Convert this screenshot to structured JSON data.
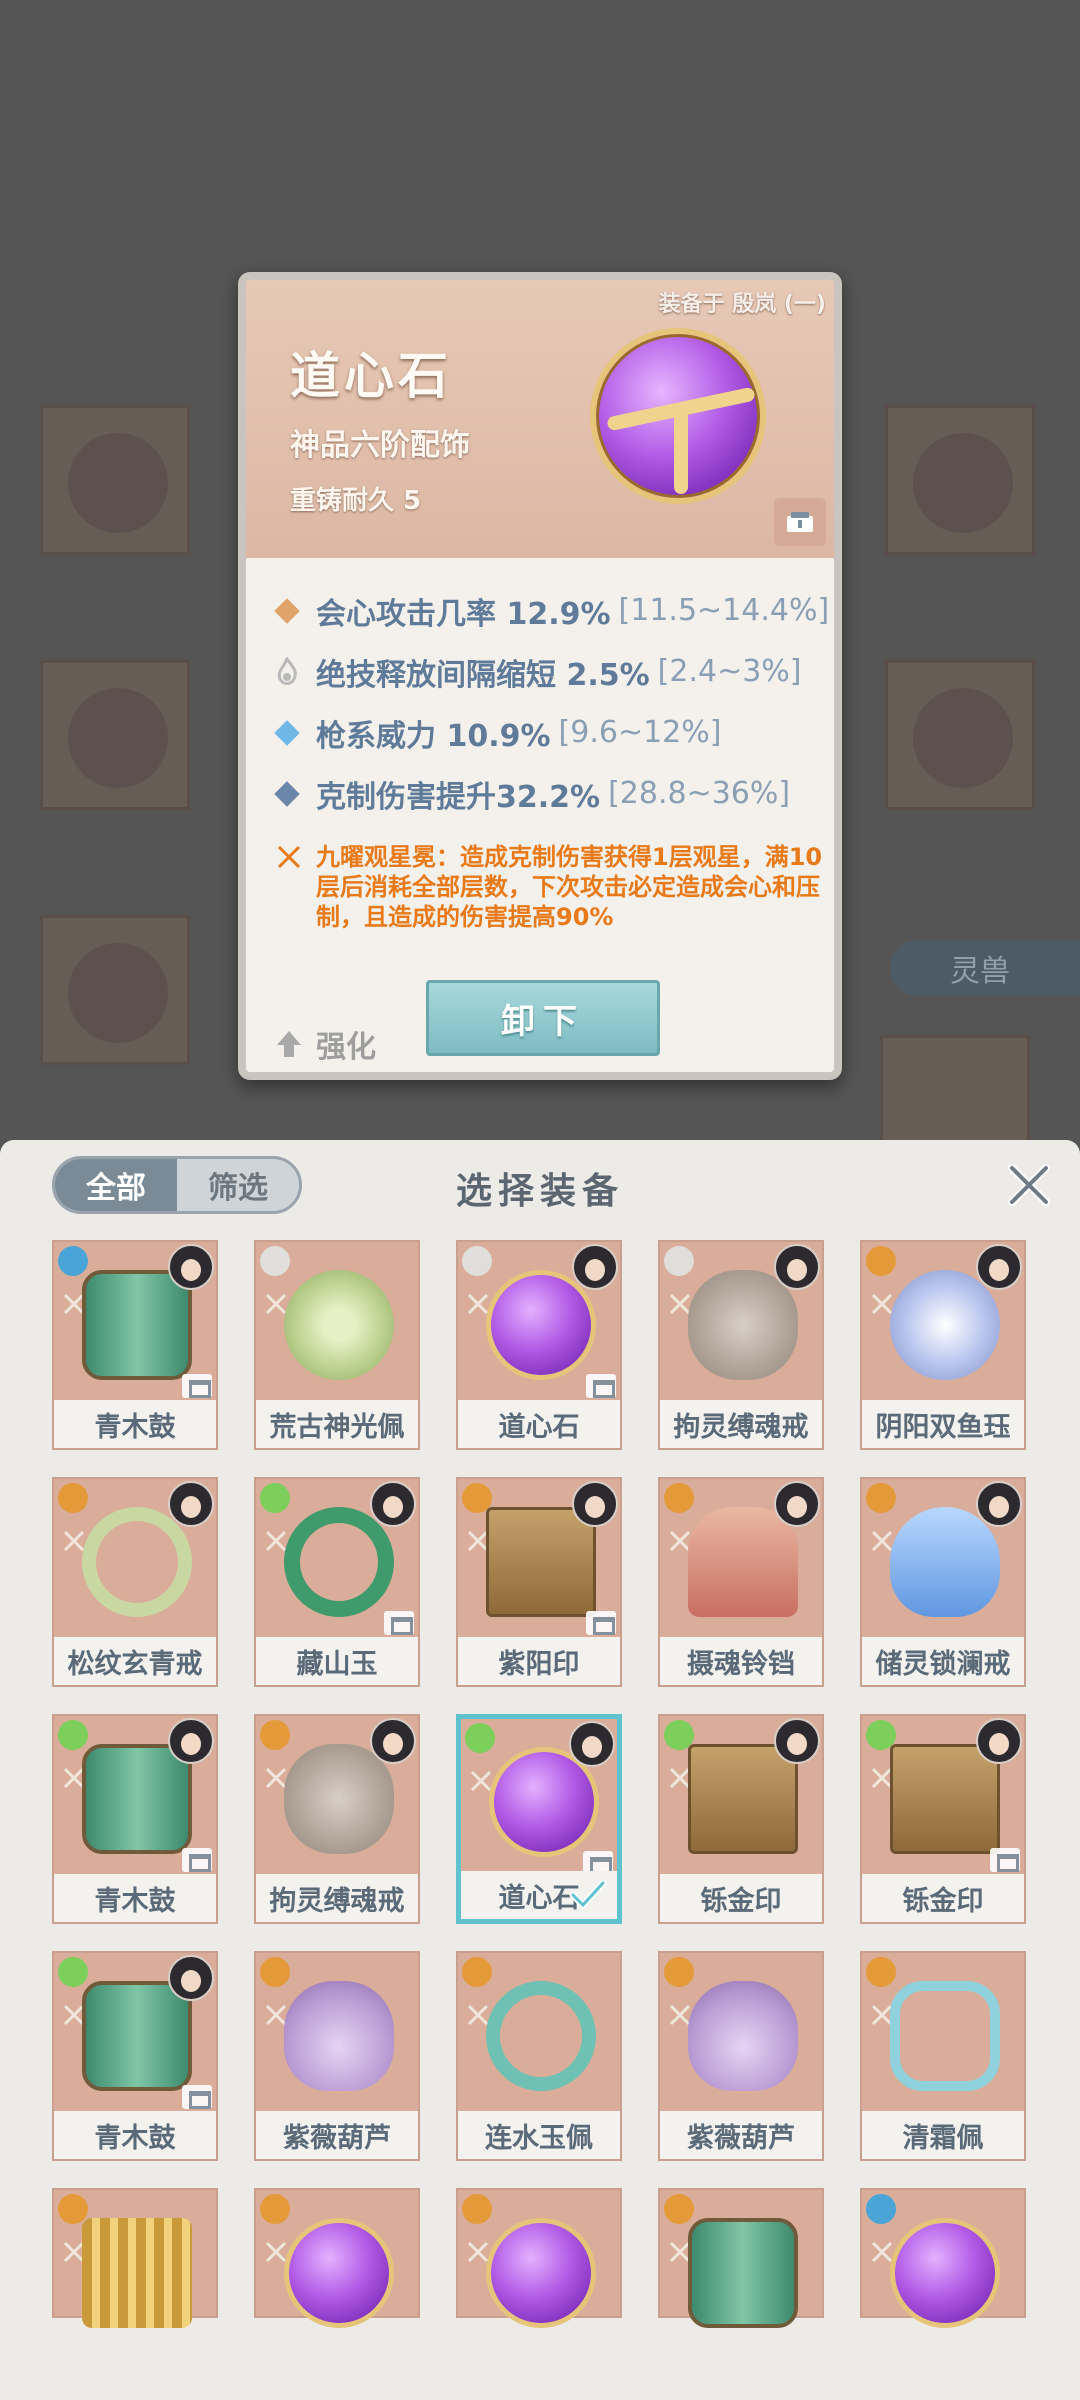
{
  "detail": {
    "equipped_on": "装备于 殷岚 (一)",
    "name": "道心石",
    "grade": "神品六阶配饰",
    "recast": "重铸耐久 5",
    "stats": [
      {
        "text": "会心攻击几率 12.9%",
        "range": "[11.5~14.4%]",
        "icon_color": "#e0a36a"
      },
      {
        "text": "绝技释放间隔缩短 2.5%",
        "range": "[2.4~3%]",
        "icon_color": "#b9b9b9"
      },
      {
        "text": "枪系威力 10.9%",
        "range": "[9.6~12%]",
        "icon_color": "#6fb8e6"
      },
      {
        "text": "克制伤害提升32.2%",
        "range": "[28.8~36%]",
        "icon_color": "#6a86a8"
      }
    ],
    "skill_text": "九曜观星冕：造成克制伤害获得1层观星，满10层后消耗全部层数，下次攻击必定造成会心和压制，且造成的伤害提高90%",
    "upgrade_label": "强化",
    "unequip_label": "卸下"
  },
  "background": {
    "pet_label": "灵兽"
  },
  "panel": {
    "title": "选择装备",
    "filters": [
      "全部",
      "筛选"
    ],
    "items": [
      {
        "name": "青木鼓",
        "art": "drum",
        "element": "#4aa4d8",
        "has_avatar": true,
        "locked": true
      },
      {
        "name": "荒古神光佩",
        "art": "pendant",
        "element": "#e0dedb",
        "has_avatar": false,
        "locked": false
      },
      {
        "name": "道心石",
        "art": "orb",
        "element": "#e0dedb",
        "has_avatar": true,
        "locked": true
      },
      {
        "name": "拘灵缚魂戒",
        "art": "beast",
        "element": "#e0dedb",
        "has_avatar": true,
        "locked": false
      },
      {
        "name": "阴阳双鱼珏",
        "art": "yinyang",
        "element": "#e59a3a",
        "has_avatar": true,
        "locked": false
      },
      {
        "name": "松纹玄青戒",
        "art": "ring",
        "element": "#e59a3a",
        "has_avatar": true,
        "locked": false
      },
      {
        "name": "藏山玉",
        "art": "jade",
        "element": "#7ccf5a",
        "has_avatar": true,
        "locked": true
      },
      {
        "name": "紫阳印",
        "art": "seal",
        "element": "#e59a3a",
        "has_avatar": true,
        "locked": true
      },
      {
        "name": "摄魂铃铛",
        "art": "bell",
        "element": "#e59a3a",
        "has_avatar": true,
        "locked": false
      },
      {
        "name": "储灵锁澜戒",
        "art": "bowl",
        "element": "#e59a3a",
        "has_avatar": true,
        "locked": false
      },
      {
        "name": "青木鼓",
        "art": "drum",
        "element": "#7ccf5a",
        "has_avatar": true,
        "locked": true
      },
      {
        "name": "拘灵缚魂戒",
        "art": "beast",
        "element": "#e59a3a",
        "has_avatar": true,
        "locked": false
      },
      {
        "name": "道心石",
        "art": "orb",
        "element": "#7ccf5a",
        "has_avatar": true,
        "locked": true,
        "selected": true
      },
      {
        "name": "铄金印",
        "art": "seal",
        "element": "#7ccf5a",
        "has_avatar": true,
        "locked": false
      },
      {
        "name": "铄金印",
        "art": "seal",
        "element": "#7ccf5a",
        "has_avatar": true,
        "locked": true
      },
      {
        "name": "青木鼓",
        "art": "drum",
        "element": "#7ccf5a",
        "has_avatar": true,
        "locked": true
      },
      {
        "name": "紫薇葫芦",
        "art": "gourd",
        "element": "#e59a3a",
        "has_avatar": false,
        "locked": false
      },
      {
        "name": "连水玉佩",
        "art": "wreath",
        "element": "#e59a3a",
        "has_avatar": false,
        "locked": false
      },
      {
        "name": "紫薇葫芦",
        "art": "gourd",
        "element": "#e59a3a",
        "has_avatar": false,
        "locked": false
      },
      {
        "name": "清霜佩",
        "art": "frost",
        "element": "#e59a3a",
        "has_avatar": false,
        "locked": false
      },
      {
        "name": "",
        "art": "coil",
        "element": "#e59a3a",
        "has_avatar": false,
        "locked": false
      },
      {
        "name": "",
        "art": "orb",
        "element": "#e59a3a",
        "has_avatar": false,
        "locked": false
      },
      {
        "name": "",
        "art": "orb",
        "element": "#e59a3a",
        "has_avatar": false,
        "locked": false
      },
      {
        "name": "",
        "art": "drum",
        "element": "#e59a3a",
        "has_avatar": false,
        "locked": false
      },
      {
        "name": "",
        "art": "orb",
        "element": "#4aa4d8",
        "has_avatar": false,
        "locked": false
      }
    ]
  }
}
